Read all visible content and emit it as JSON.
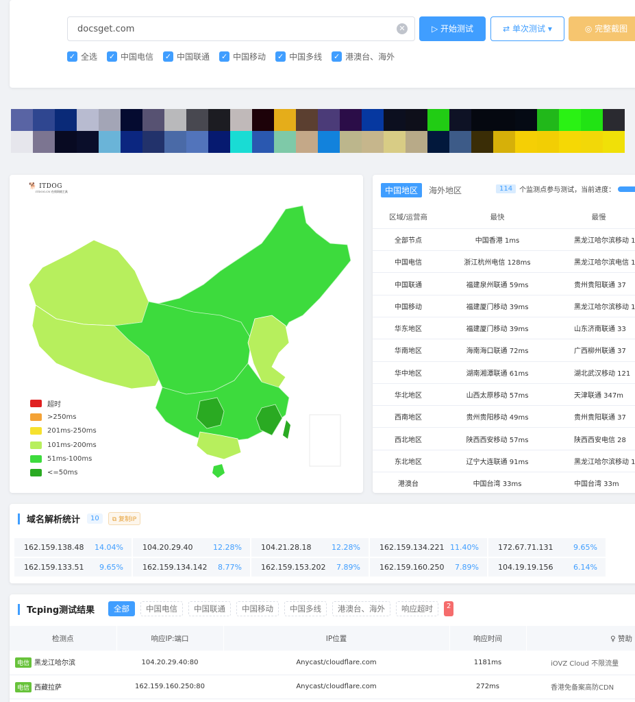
{
  "search": {
    "value": "docsget.com",
    "clear_icon": "clear-circle-icon"
  },
  "buttons": {
    "start": "▷ 开始测试",
    "single": "⇄ 单次测试 ▾",
    "screenshot": "◎ 完整截图"
  },
  "checkboxes": [
    "全选",
    "中国电信",
    "中国联通",
    "中国移动",
    "中国多线",
    "港澳台、海外"
  ],
  "mosaic": {
    "row1": [
      "#5964a4",
      "#2f4690",
      "#0a2a78",
      "#b8bbd0",
      "#a3a5b6",
      "#050b30",
      "#575272",
      "#b9b9bb",
      "#484850",
      "#1c1c22",
      "#c0b9b9",
      "#1d0209",
      "#e5ad1a",
      "#5b3f30",
      "#4b3b78",
      "#2b0d48",
      "#0638a0",
      "#0c0f1f",
      "#0e0f1a",
      "#21cc14",
      "#0e1225",
      "#050810",
      "#050810",
      "#050a14",
      "#21b81a",
      "#2af214",
      "#21e314",
      "#2a2a30"
    ],
    "row2": [
      "#e6e6ec",
      "#7c7591",
      "#080a22",
      "#0a0e2a",
      "#6ab4d8",
      "#0b2680",
      "#22326b",
      "#4a6aa7",
      "#5274bb",
      "#061a70",
      "#19dcd4",
      "#2a58b0",
      "#7ec9a8",
      "#c4a888",
      "#1282dc",
      "#bcb68c",
      "#c6b68c",
      "#d8cc85",
      "#b8aa88",
      "#02183c",
      "#3d5b88",
      "#3a2d06",
      "#d6b009",
      "#f5cf05",
      "#f2ce04",
      "#f5d805",
      "#f2d808",
      "#f0e008"
    ]
  },
  "map_panel": {
    "logo": "ITDOG",
    "logo_sub": "ITDOG.CN 在线网络工具",
    "legend": [
      {
        "label": "超时",
        "color": "#e02020"
      },
      {
        "label": ">250ms",
        "color": "#f4a236"
      },
      {
        "label": "201ms-250ms",
        "color": "#f6e12e"
      },
      {
        "label": "101ms-200ms",
        "color": "#b7ef5d"
      },
      {
        "label": "51ms-100ms",
        "color": "#3ddb3d"
      },
      {
        "label": "<=50ms",
        "color": "#2aaa22"
      }
    ]
  },
  "region_table": {
    "tabs": [
      "中国地区",
      "海外地区"
    ],
    "probe_count": "114",
    "probe_text": "个监测点参与测试，当前进度：",
    "progress": 1.0,
    "headers": [
      "区域/运营商",
      "最快",
      "最慢"
    ],
    "rows": [
      [
        "全部节点",
        "中国香港 1ms",
        "黑龙江哈尔滨移动 1"
      ],
      [
        "中国电信",
        "浙江杭州电信 128ms",
        "黑龙江哈尔滨电信 1"
      ],
      [
        "中国联通",
        "福建泉州联通 59ms",
        "贵州贵阳联通 37"
      ],
      [
        "中国移动",
        "福建厦门移动 39ms",
        "黑龙江哈尔滨移动 1"
      ],
      [
        "华东地区",
        "福建厦门移动 39ms",
        "山东济南联通 33"
      ],
      [
        "华南地区",
        "海南海口联通 72ms",
        "广西柳州联通 37"
      ],
      [
        "华中地区",
        "湖南湘潭联通 61ms",
        "湖北武汉移动 121"
      ],
      [
        "华北地区",
        "山西太原移动 57ms",
        "天津联通 347m"
      ],
      [
        "西南地区",
        "贵州贵阳移动 49ms",
        "贵州贵阳联通 37"
      ],
      [
        "西北地区",
        "陕西西安移动 57ms",
        "陕西西安电信 28"
      ],
      [
        "东北地区",
        "辽宁大连联通 91ms",
        "黑龙江哈尔滨移动 1"
      ],
      [
        "港澳台",
        "中国台湾 33ms",
        "中国台湾 33m"
      ]
    ]
  },
  "dns": {
    "title": "域名解析统计",
    "count": "10",
    "copy_label": "⧉ 复制IP",
    "items": [
      {
        "ip": "162.159.138.48",
        "pct": "14.04%"
      },
      {
        "ip": "104.20.29.40",
        "pct": "12.28%"
      },
      {
        "ip": "104.21.28.18",
        "pct": "12.28%"
      },
      {
        "ip": "162.159.134.221",
        "pct": "11.40%"
      },
      {
        "ip": "172.67.71.131",
        "pct": "9.65%"
      },
      {
        "ip": "162.159.133.51",
        "pct": "9.65%"
      },
      {
        "ip": "162.159.134.142",
        "pct": "8.77%"
      },
      {
        "ip": "162.159.153.202",
        "pct": "7.89%"
      },
      {
        "ip": "162.159.160.250",
        "pct": "7.89%"
      },
      {
        "ip": "104.19.19.156",
        "pct": "6.14%"
      }
    ]
  },
  "tcping": {
    "title": "Tcping测试结果",
    "filters": [
      "全部",
      "中国电信",
      "中国联通",
      "中国移动",
      "中国多线",
      "港澳台、海外",
      "响应超时"
    ],
    "timeout_count": "2",
    "headers": [
      "检测点",
      "响应IP:端口",
      "IP位置",
      "响应时间",
      "♀ 赞助"
    ],
    "rows": [
      {
        "tag": "电信",
        "loc": "黑龙江哈尔滨",
        "ip": "104.20.29.40:80",
        "geo": "Anycast/cloudflare.com",
        "time": "1181ms",
        "sponsor": "iOVZ Cloud 不限流量"
      },
      {
        "tag": "电信",
        "loc": "西藏拉萨",
        "ip": "162.159.160.250:80",
        "geo": "Anycast/cloudflare.com",
        "time": "272ms",
        "sponsor": "香港免备案高防CDN"
      }
    ]
  }
}
